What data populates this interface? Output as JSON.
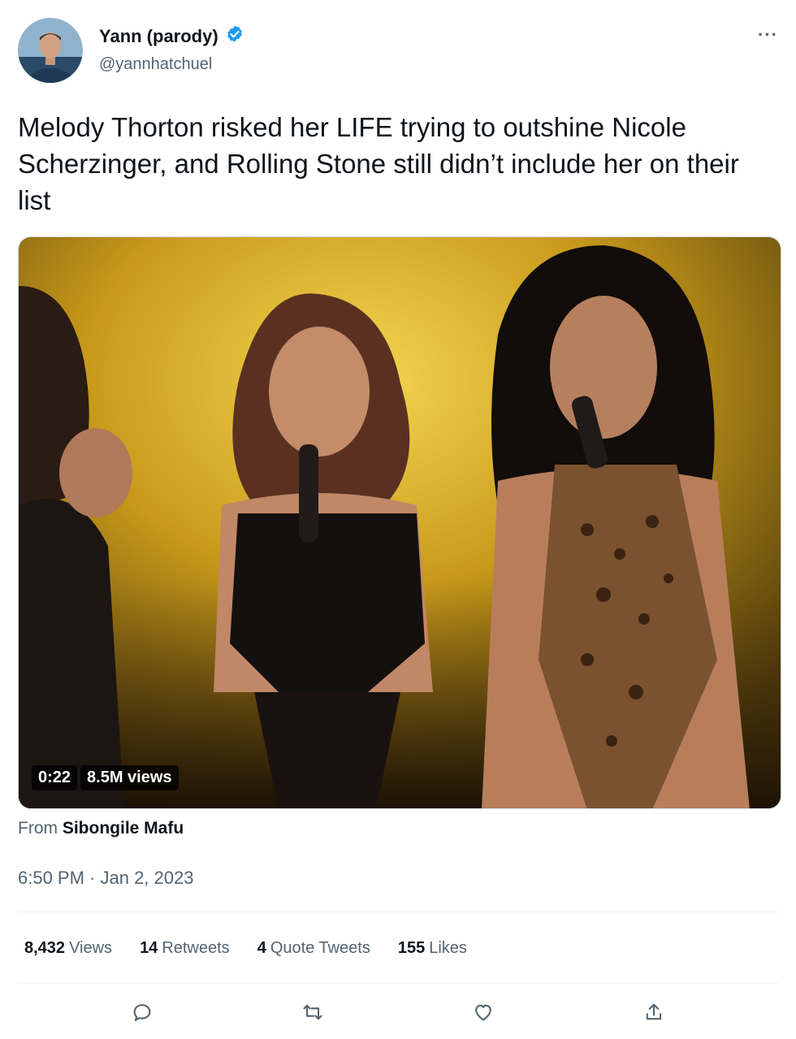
{
  "author": {
    "name": "Yann (parody)",
    "handle": "@yannhatchuel",
    "verified": true
  },
  "more_label": "···",
  "tweet_text": "Melody Thorton risked her LIFE trying to outshine Nicole Scherzinger, and Rolling Stone still didn’t include her on their list",
  "video": {
    "duration": "0:22",
    "views": "8.5M views"
  },
  "attribution": {
    "prefix": "From",
    "source": "Sibongile Mafu"
  },
  "timestamp": "6:50 PM · Jan 2, 2023",
  "stats": {
    "views_count": "8,432",
    "views_label": "Views",
    "retweets_count": "14",
    "retweets_label": "Retweets",
    "quotes_count": "4",
    "quotes_label": "Quote Tweets",
    "likes_count": "155",
    "likes_label": "Likes"
  },
  "colors": {
    "verified_badge": "#1d9bf0",
    "secondary_text": "#536471",
    "primary_text": "#0f1419"
  },
  "icons": [
    "verified-badge-icon",
    "more-icon",
    "reply-icon",
    "retweet-icon",
    "like-icon",
    "share-icon"
  ]
}
